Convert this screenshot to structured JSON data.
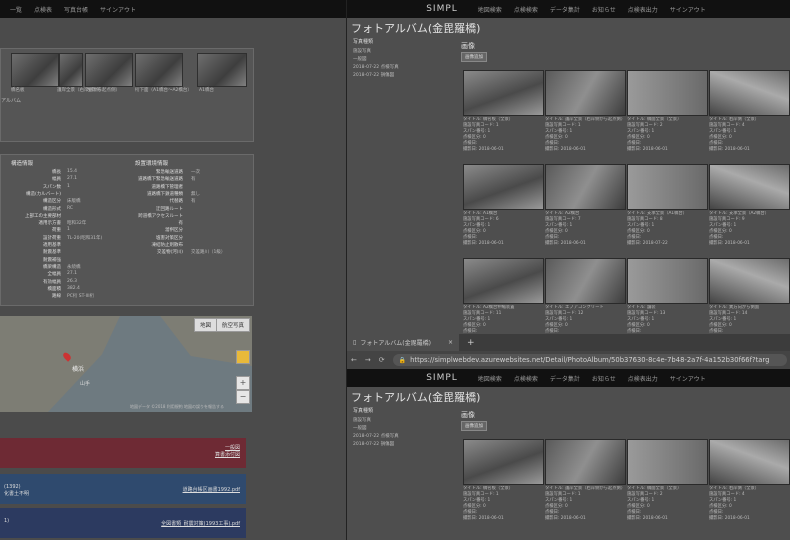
{
  "left": {
    "nav": [
      "一覧",
      "点検表",
      "写真台帳",
      "サインアウト"
    ],
    "thumb_captions": [
      "橋名板",
      "護岸全景（右岸側から起点側）",
      "左岸側",
      "桁下面（A1橋台〜A2橋台）",
      "A1橋台"
    ],
    "album_label": "アルバム",
    "struct": {
      "heading": "構造情報",
      "rows": [
        {
          "k": "橋長",
          "v": "15.4"
        },
        {
          "k": "幅員",
          "v": "27.1"
        },
        {
          "k": "スパン数",
          "v": "1"
        },
        {
          "k": "構造(カルバート)",
          "v": ""
        },
        {
          "k": "構造区分",
          "v": "床版橋"
        },
        {
          "k": "構造形式",
          "v": "RC"
        },
        {
          "k": "上部工の主要部材",
          "v": ""
        },
        {
          "k": "適用示方書",
          "v": "昭和32年"
        },
        {
          "k": "荷重",
          "v": "1"
        },
        {
          "k": "設計荷重",
          "v": "TL-20(昭和31年)"
        },
        {
          "k": "適用基準",
          "v": ""
        },
        {
          "k": "耐震基準",
          "v": ""
        },
        {
          "k": "耐震補強",
          "v": ""
        },
        {
          "k": "橋梁構造",
          "v": "永続橋"
        },
        {
          "k": "全幅員",
          "v": "27.1"
        },
        {
          "k": "有効幅員",
          "v": "26.3"
        },
        {
          "k": "橋面積",
          "v": "382.4"
        },
        {
          "k": "路線",
          "v": "PC桁 ST-III桁"
        }
      ]
    },
    "env": {
      "heading": "設置環境情報",
      "rows": [
        {
          "k": "緊急輸送道路",
          "v": "一次"
        },
        {
          "k": "道路橋下緊急輸送道路",
          "v": "有"
        },
        {
          "k": "道路橋下管理者",
          "v": ""
        },
        {
          "k": "道路橋下鉄道種類",
          "v": "無し"
        },
        {
          "k": "代替路",
          "v": "有"
        },
        {
          "k": "迂回路ルート",
          "v": ""
        },
        {
          "k": "跨道橋アクセスルート",
          "v": ""
        },
        {
          "k": "有",
          "v": ""
        },
        {
          "k": "溜桝区分",
          "v": ""
        },
        {
          "k": "塩害対策区分",
          "v": ""
        },
        {
          "k": "凍結防止剤散布",
          "v": ""
        },
        {
          "k": "交差物(河川)",
          "v": "交差路川（1級）"
        }
      ]
    },
    "map": {
      "btn_map": "地図",
      "btn_sat": "航空写真",
      "footer": "地図データ ©2018   利用規約   地図の誤りを報告する",
      "place": "横浜",
      "place2": "山手"
    },
    "docs": [
      {
        "title": "",
        "link1": "一般図",
        "link2": "算書添付図"
      },
      {
        "title": "(1392)",
        "sub": "化書土不明",
        "link1": "道路台帳区画書1992.pdf"
      },
      {
        "title": "1)",
        "link1": "全図書類_耐震対策(1993工事).pdf"
      }
    ],
    "colors": {
      "doc1": "#6e2a34",
      "doc2": "#2f4a6e",
      "doc3": "#2c3a60"
    }
  },
  "right": {
    "brand": "SIMPL",
    "nav": [
      "地図検索",
      "点検検索",
      "データ集計",
      "お知らせ",
      "点検表出力",
      "サインアウト"
    ],
    "title": "フォトアルバム(金毘羅橋)",
    "photo_type_label": "写真種類",
    "photo_type_value": "施設写真",
    "list_label": "一般図",
    "dates": [
      "2018-07-22 点検写真",
      "2018-07-22 損傷図"
    ],
    "images_heading": "画像",
    "btn_label": "画像追加",
    "cards": [
      {
        "t": "タイトル: 橋名板（全景）",
        "c": "施設写真コード: 1",
        "s": "スパン番号: 1",
        "n": "点検区分: 0",
        "r": "点検日:",
        "d": "撮影日: 2018-06-01"
      },
      {
        "t": "タイトル: 護岸全景（右岸側から起点側）",
        "c": "施設写真コード: 1",
        "s": "スパン番号: 1",
        "n": "点検区分: 0",
        "r": "点検日:",
        "d": "撮影日: 2018-06-01"
      },
      {
        "t": "タイトル: 橋面全景（全景）",
        "c": "施設写真コード: 2",
        "s": "スパン番号: 1",
        "n": "点検区分: 0",
        "r": "点検日:",
        "d": "撮影日: 2018-06-01"
      },
      {
        "t": "タイトル: 右岸側（全景）",
        "c": "施設写真コード: 4",
        "s": "スパン番号: 1",
        "n": "点検区分: 0",
        "r": "点検日:",
        "d": "撮影日: 2018-06-01"
      },
      {
        "t": "タイトル: A1橋台",
        "c": "施設写真コード: 6",
        "s": "スパン番号: 1",
        "n": "点検区分: 0",
        "r": "点検日:",
        "d": "撮影日: 2018-06-01"
      },
      {
        "t": "タイトル: A2橋台",
        "c": "施設写真コード: 7",
        "s": "スパン番号: 1",
        "n": "点検区分: 0",
        "r": "点検日:",
        "d": "撮影日: 2018-06-01"
      },
      {
        "t": "タイトル: 支承全景（A1橋台）",
        "c": "施設写真コード: 8",
        "s": "スパン番号: 1",
        "n": "点検区分: 0",
        "r": "点検日:",
        "d": "撮影日: 2018-07-22"
      },
      {
        "t": "タイトル: 支承全景（A2橋台）",
        "c": "施設写真コード: 9",
        "s": "スパン番号: 1",
        "n": "点検区分: 0",
        "r": "点検日:",
        "d": "撮影日: 2018-06-01"
      },
      {
        "t": "タイトル: A2橋台伸縮装置",
        "c": "施設写真コード: 11",
        "s": "スパン番号: 1",
        "n": "点検区分: 0",
        "r": "点検日:",
        "d": "撮影日: 2018-06-01"
      },
      {
        "t": "タイトル: エプアコンクリート",
        "c": "施設写真コード: 12",
        "s": "スパン番号: 1",
        "n": "点検区分: 0",
        "r": "点検日:",
        "d": "撮影日: 2018-06-01"
      },
      {
        "t": "タイトル: 舗装",
        "c": "施設写真コード: 13",
        "s": "スパン番号: 1",
        "n": "点検区分: 0",
        "r": "点検日:",
        "d": "撮影日: 2018-06-01"
      },
      {
        "t": "タイトル: 異方向から側面",
        "c": "施設写真コード: 14",
        "s": "スパン番号: 1",
        "n": "点検区分: 0",
        "r": "点検日:",
        "d": "撮影日: 2018-06-01"
      }
    ]
  },
  "browser": {
    "tab_title": "フォトアルバム(金毘羅橋)",
    "tab_close": "×",
    "new_tab": "+",
    "url": "https://simplwebdev.azurewebsites.net/Detail/PhotoAlbum/50b37630-8c4e-7b48-2a7f-4a152b30f66f?targ",
    "lock": "🔒",
    "back": "←",
    "forward": "→",
    "reload": "⟳"
  }
}
